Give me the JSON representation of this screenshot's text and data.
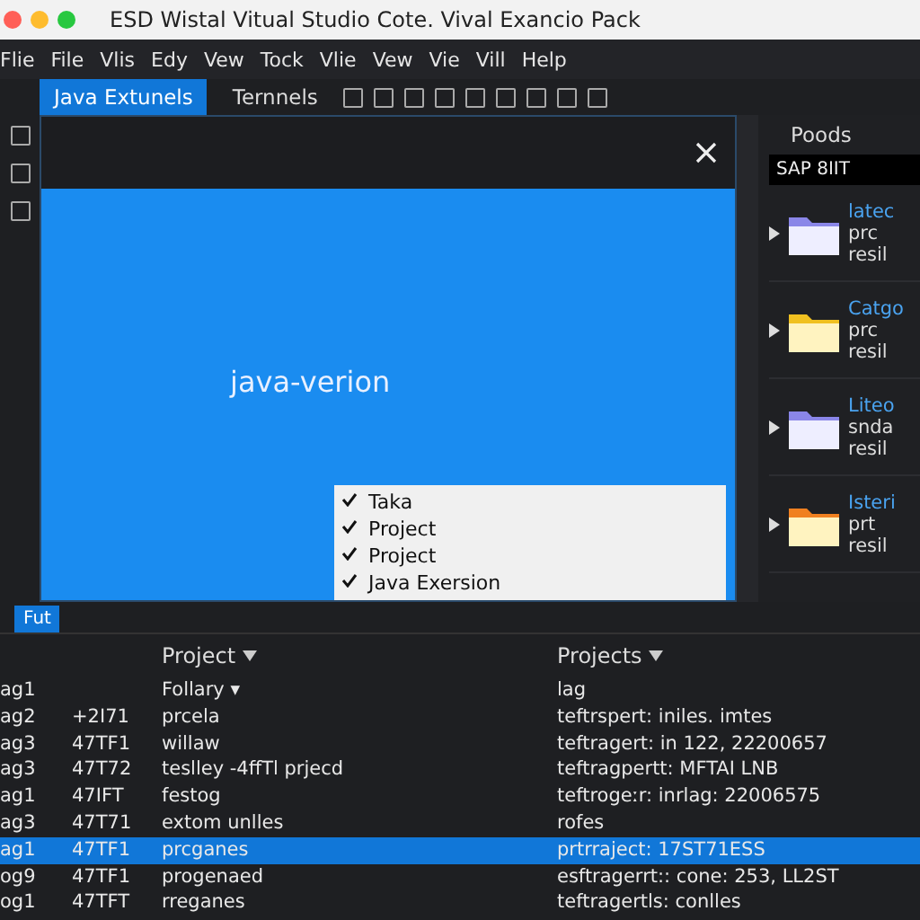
{
  "window": {
    "title": "ESD Wistal Vitual Studio Cote. Vival Exancio Pack"
  },
  "menu": [
    "Flie",
    "File",
    "Vlis",
    "Edy",
    "Vew",
    "Tock",
    "Vlie",
    "Vew",
    "Vie",
    "Vill",
    "Help"
  ],
  "tabs": [
    {
      "label": "Java Extunels",
      "selected": true
    },
    {
      "label": "Ternnels",
      "selected": false
    }
  ],
  "editor": {
    "heading": "java-verion",
    "dropdown": [
      {
        "label": "Taka",
        "checked": true
      },
      {
        "label": "Project",
        "checked": true
      },
      {
        "label": "Project",
        "checked": true
      },
      {
        "label": "Java Exersion",
        "checked": true
      }
    ]
  },
  "side_panel": {
    "title": "Poods",
    "banner": "SAP 8IIT",
    "items": [
      {
        "kind": "folder",
        "title": "latec",
        "line1": "prc",
        "line2": "resil"
      },
      {
        "kind": "file",
        "title": "Catgo",
        "line1": "prc",
        "line2": "resil"
      },
      {
        "kind": "folder",
        "title": "Liteo",
        "line1": "snda",
        "line2": "resil"
      },
      {
        "kind": "package",
        "title": "Isteri",
        "line1": "prt",
        "line2": "resil"
      }
    ]
  },
  "bottom_panel": {
    "tab": "Fut",
    "columns": [
      "Project",
      "Projects"
    ],
    "rows": [
      {
        "tag": "ag1",
        "id": "",
        "name": "Follary ▾",
        "detail": "lag",
        "selected": false
      },
      {
        "tag": "ag2",
        "id": "+2I71",
        "name": "prcela",
        "detail": "teftrspert: iniles. imtes",
        "selected": false
      },
      {
        "tag": "ag3",
        "id": "47TF1",
        "name": "willaw",
        "detail": "teftragert: in 122, 22200657",
        "selected": false
      },
      {
        "tag": "ag3",
        "id": "47T72",
        "name": "teslley -4ffTl prjecd",
        "detail": "teftragpertt: MFTAI LNB",
        "selected": false
      },
      {
        "tag": "ag1",
        "id": "47IFT",
        "name": "festog",
        "detail": "teftrogeːr: inrlag: 22006575",
        "selected": false
      },
      {
        "tag": "ag3",
        "id": "47T71",
        "name": "extom unlles",
        "detail": "rofes",
        "selected": false
      },
      {
        "tag": "ag1",
        "id": "47TF1",
        "name": "prcganes",
        "detail": "prtrraject: 17ST71ESS",
        "selected": true
      },
      {
        "tag": "og9",
        "id": "47TF1",
        "name": "progenaed",
        "detail": "esftragerrt:: cone: 253, LL2ST",
        "selected": false
      },
      {
        "tag": "og1",
        "id": "47TFT",
        "name": "rreganes",
        "detail": "teftragertls: conlles",
        "selected": false
      }
    ]
  }
}
